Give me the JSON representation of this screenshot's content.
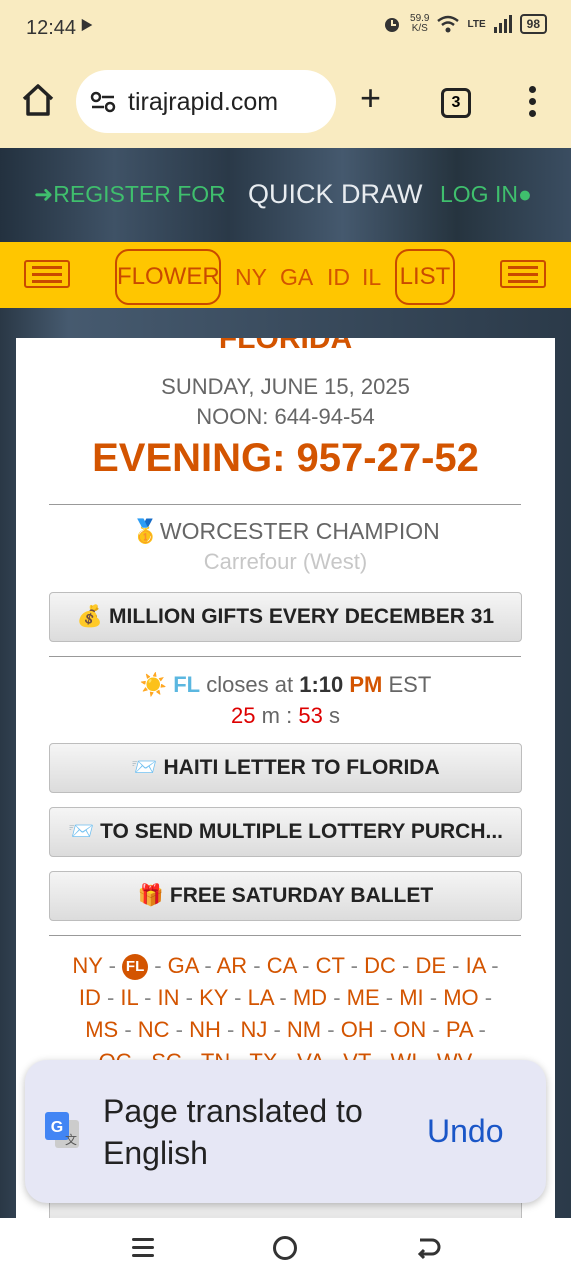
{
  "status_bar": {
    "time": "12:44",
    "notification_glyph": "⯈",
    "speed_value": "59.9",
    "speed_unit": "K/S",
    "network": "LTE",
    "battery": "98"
  },
  "browser": {
    "url": "tirajrapid.com",
    "tab_count": "3",
    "new_tab_glyph": "+"
  },
  "site_header": {
    "register": "REGISTER FOR",
    "quick_draw": "QUICK DRAW",
    "login": "LOG IN"
  },
  "nav": {
    "flower": "FLOWER",
    "states": [
      "NY",
      "GA",
      "ID",
      "IL"
    ],
    "list": "LIST"
  },
  "result": {
    "state_heading": "FLORIDA",
    "date": "SUNDAY, JUNE 15, 2025",
    "noon": "NOON: 644-94-54",
    "evening": "EVENING: 957-27-52",
    "champion_emoji": "🥇",
    "champion": "WORCESTER CHAMPION",
    "location": "Carrefour (West)"
  },
  "buttons": {
    "million": {
      "emoji": "💰",
      "label": "MILLION GIFTS EVERY DECEMBER 31"
    },
    "haiti": {
      "emoji": "📨",
      "label": "HAITI LETTER TO FLORIDA"
    },
    "multiple": {
      "emoji": "📨",
      "label": "TO SEND MULTIPLE LOTTERY PURCH..."
    },
    "ballet": {
      "emoji": "🎁",
      "label": "FREE SATURDAY BALLET"
    }
  },
  "closing": {
    "sun_emoji": "☀️",
    "state": "FL",
    "closes_at": "closes at",
    "time": "1:10",
    "pm": "PM",
    "tz": "EST",
    "minutes": "25",
    "m_label": "m :",
    "seconds": "53",
    "s_label": "s"
  },
  "state_links": {
    "line1": [
      "NY",
      "FL",
      "GA",
      "AR",
      "CA",
      "CT",
      "DC",
      "DE",
      "IA"
    ],
    "line2": [
      "ID",
      "IL",
      "IN",
      "KY",
      "LA",
      "MD",
      "ME",
      "MI",
      "MO"
    ],
    "line3": [
      "MS",
      "NC",
      "NH",
      "NJ",
      "NM",
      "OH",
      "ON",
      "PA"
    ],
    "line4": [
      "OC",
      "SC",
      "TN",
      "TX",
      "VA",
      "VT",
      "WI",
      "WV"
    ]
  },
  "toast": {
    "message": "Page translated to English",
    "undo": "Undo"
  },
  "colors": {
    "accent_orange": "#d35400",
    "nav_yellow": "#ffc600",
    "green": "#3fbf6d",
    "link_blue": "#1a56c7"
  }
}
